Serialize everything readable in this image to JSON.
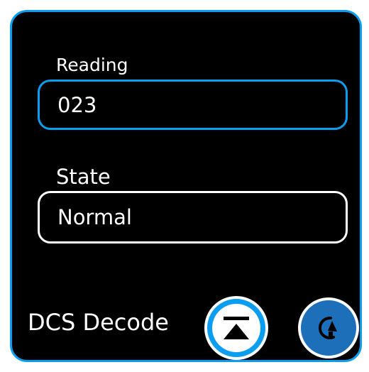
{
  "reading": {
    "label": "Reading",
    "value": "023"
  },
  "state": {
    "label": "State",
    "value": "Normal"
  },
  "dcs": {
    "label": "DCS Decode"
  },
  "icons": {
    "decode_button_icon": "eject-up-icon",
    "rotate_button_icon": "rotate-icon"
  },
  "colors": {
    "accent": "#0a9df0",
    "accent_dark": "#1c6fb8",
    "background": "#000000",
    "text": "#ffffff"
  }
}
